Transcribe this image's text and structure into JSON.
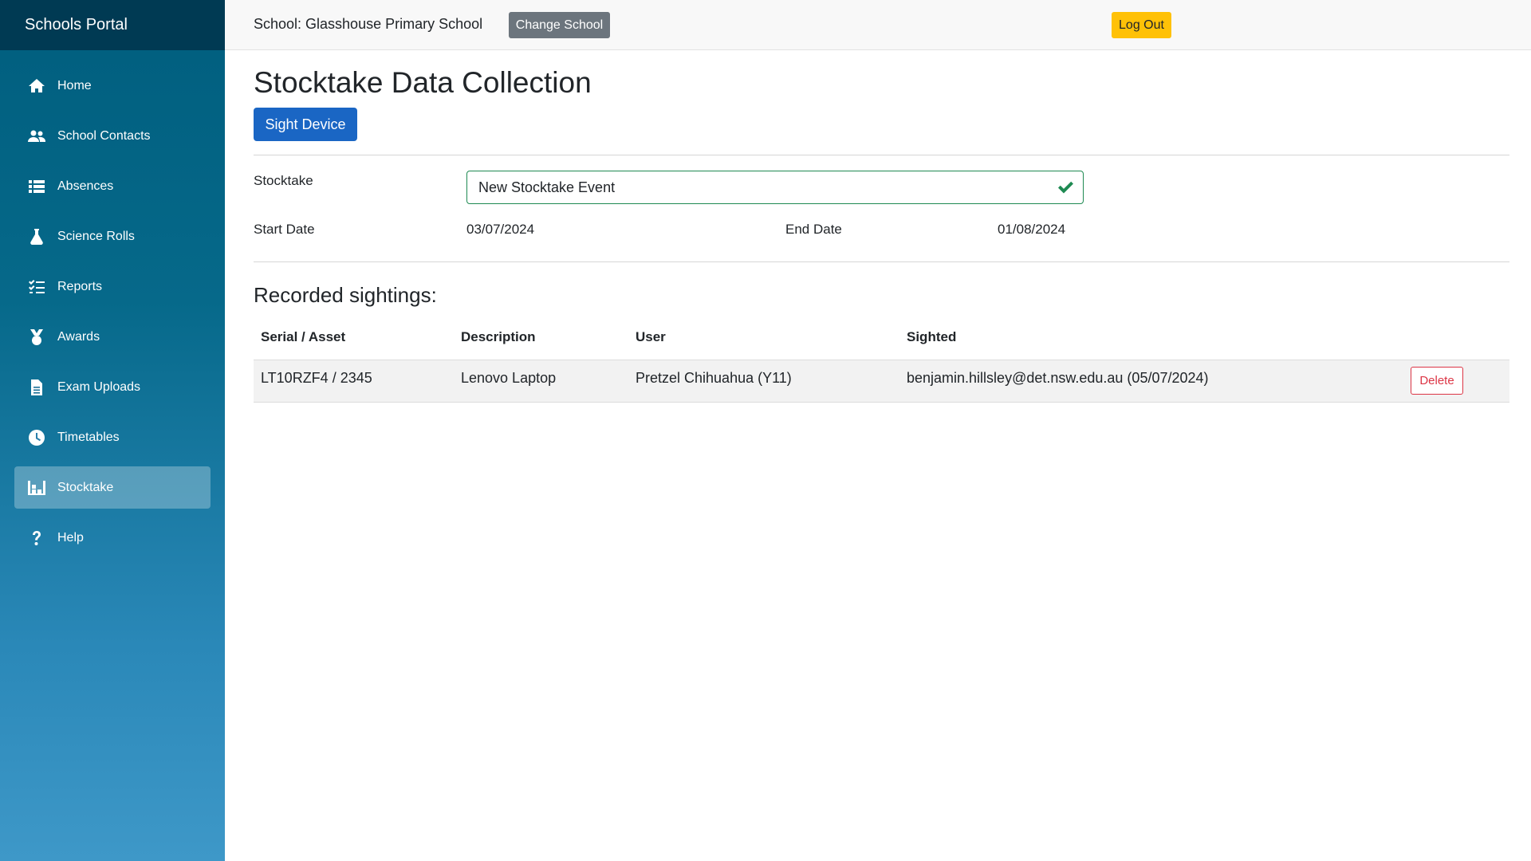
{
  "app": {
    "title": "Schools Portal"
  },
  "sidebar": {
    "items": [
      {
        "label": "Home",
        "icon": "home-icon"
      },
      {
        "label": "School Contacts",
        "icon": "users-icon"
      },
      {
        "label": "Absences",
        "icon": "list-icon"
      },
      {
        "label": "Science Rolls",
        "icon": "flask-icon"
      },
      {
        "label": "Reports",
        "icon": "checklist-icon"
      },
      {
        "label": "Awards",
        "icon": "medal-icon"
      },
      {
        "label": "Exam Uploads",
        "icon": "file-icon"
      },
      {
        "label": "Timetables",
        "icon": "clock-icon"
      },
      {
        "label": "Stocktake",
        "icon": "warehouse-icon",
        "active": true
      },
      {
        "label": "Help",
        "icon": "question-icon"
      }
    ]
  },
  "topbar": {
    "school_label": "School: Glasshouse Primary School",
    "change_school": "Change School",
    "log_out": "Log Out"
  },
  "page": {
    "title": "Stocktake Data Collection",
    "sight_device": "Sight Device",
    "stocktake_label": "Stocktake",
    "stocktake_value": "New Stocktake Event",
    "start_date_label": "Start Date",
    "start_date": "03/07/2024",
    "end_date_label": "End Date",
    "end_date": "01/08/2024"
  },
  "sightings": {
    "title": "Recorded sightings:",
    "columns": [
      "Serial / Asset",
      "Description",
      "User",
      "Sighted"
    ],
    "rows": [
      {
        "serial": "LT10RZF4 / 2345",
        "description": "Lenovo Laptop",
        "user": "Pretzel Chihuahua (Y11)",
        "sighted": "benjamin.hillsley@det.nsw.edu.au (05/07/2024)",
        "action": "Delete"
      }
    ]
  },
  "colors": {
    "sidebar_top": "#005e7e",
    "sidebar_bottom": "#3e98c8",
    "brand_bg": "#003a53",
    "primary": "#1a66c4",
    "secondary": "#6c757d",
    "warning": "#ffc107",
    "danger": "#dc3545",
    "valid": "#1e8a52"
  }
}
